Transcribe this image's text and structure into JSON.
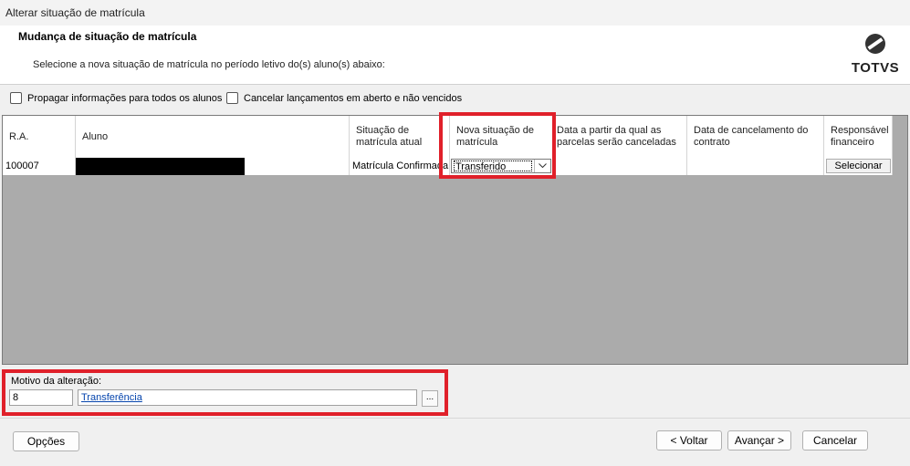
{
  "window": {
    "title": "Alterar situação de matrícula"
  },
  "header": {
    "title": "Mudança de situação de matrícula",
    "subtitle": "Selecione a nova situação de matrícula no período letivo do(s) aluno(s) abaixo:",
    "logo_text": "TOTVS"
  },
  "options": {
    "propagate_label": "Propagar informações para todos os alunos",
    "cancel_label": "Cancelar lançamentos em aberto e não vencidos"
  },
  "grid": {
    "columns": {
      "ra": "R.A.",
      "aluno": "Aluno",
      "situacao_atual": "Situação de matrícula atual",
      "nova_situacao": "Nova situação de matrícula",
      "data_parcelas": "Data a partir da qual as parcelas serão canceladas",
      "data_cancelamento": "Data de cancelamento do contrato",
      "responsavel": "Responsável financeiro"
    },
    "rows": [
      {
        "ra": "100007",
        "aluno": "",
        "situacao_atual": "Matrícula Confirmada",
        "nova_situacao": "Transferido",
        "data_parcelas": "",
        "data_cancelamento": "",
        "responsavel_button": "Selecionar"
      }
    ]
  },
  "motivo": {
    "label": "Motivo da alteração:",
    "code": "8",
    "description": "Transferência",
    "browse_label": "..."
  },
  "footer": {
    "options_label": "Opções",
    "back_label": "< Voltar",
    "next_label": "Avançar >",
    "cancel_label": "Cancelar"
  },
  "colors": {
    "highlight": "#e0202a",
    "grid_bg": "#ababab",
    "link": "#0645ad"
  },
  "icons": {
    "logo": "totvs-logo-icon",
    "dropdown": "chevron-down-icon"
  }
}
